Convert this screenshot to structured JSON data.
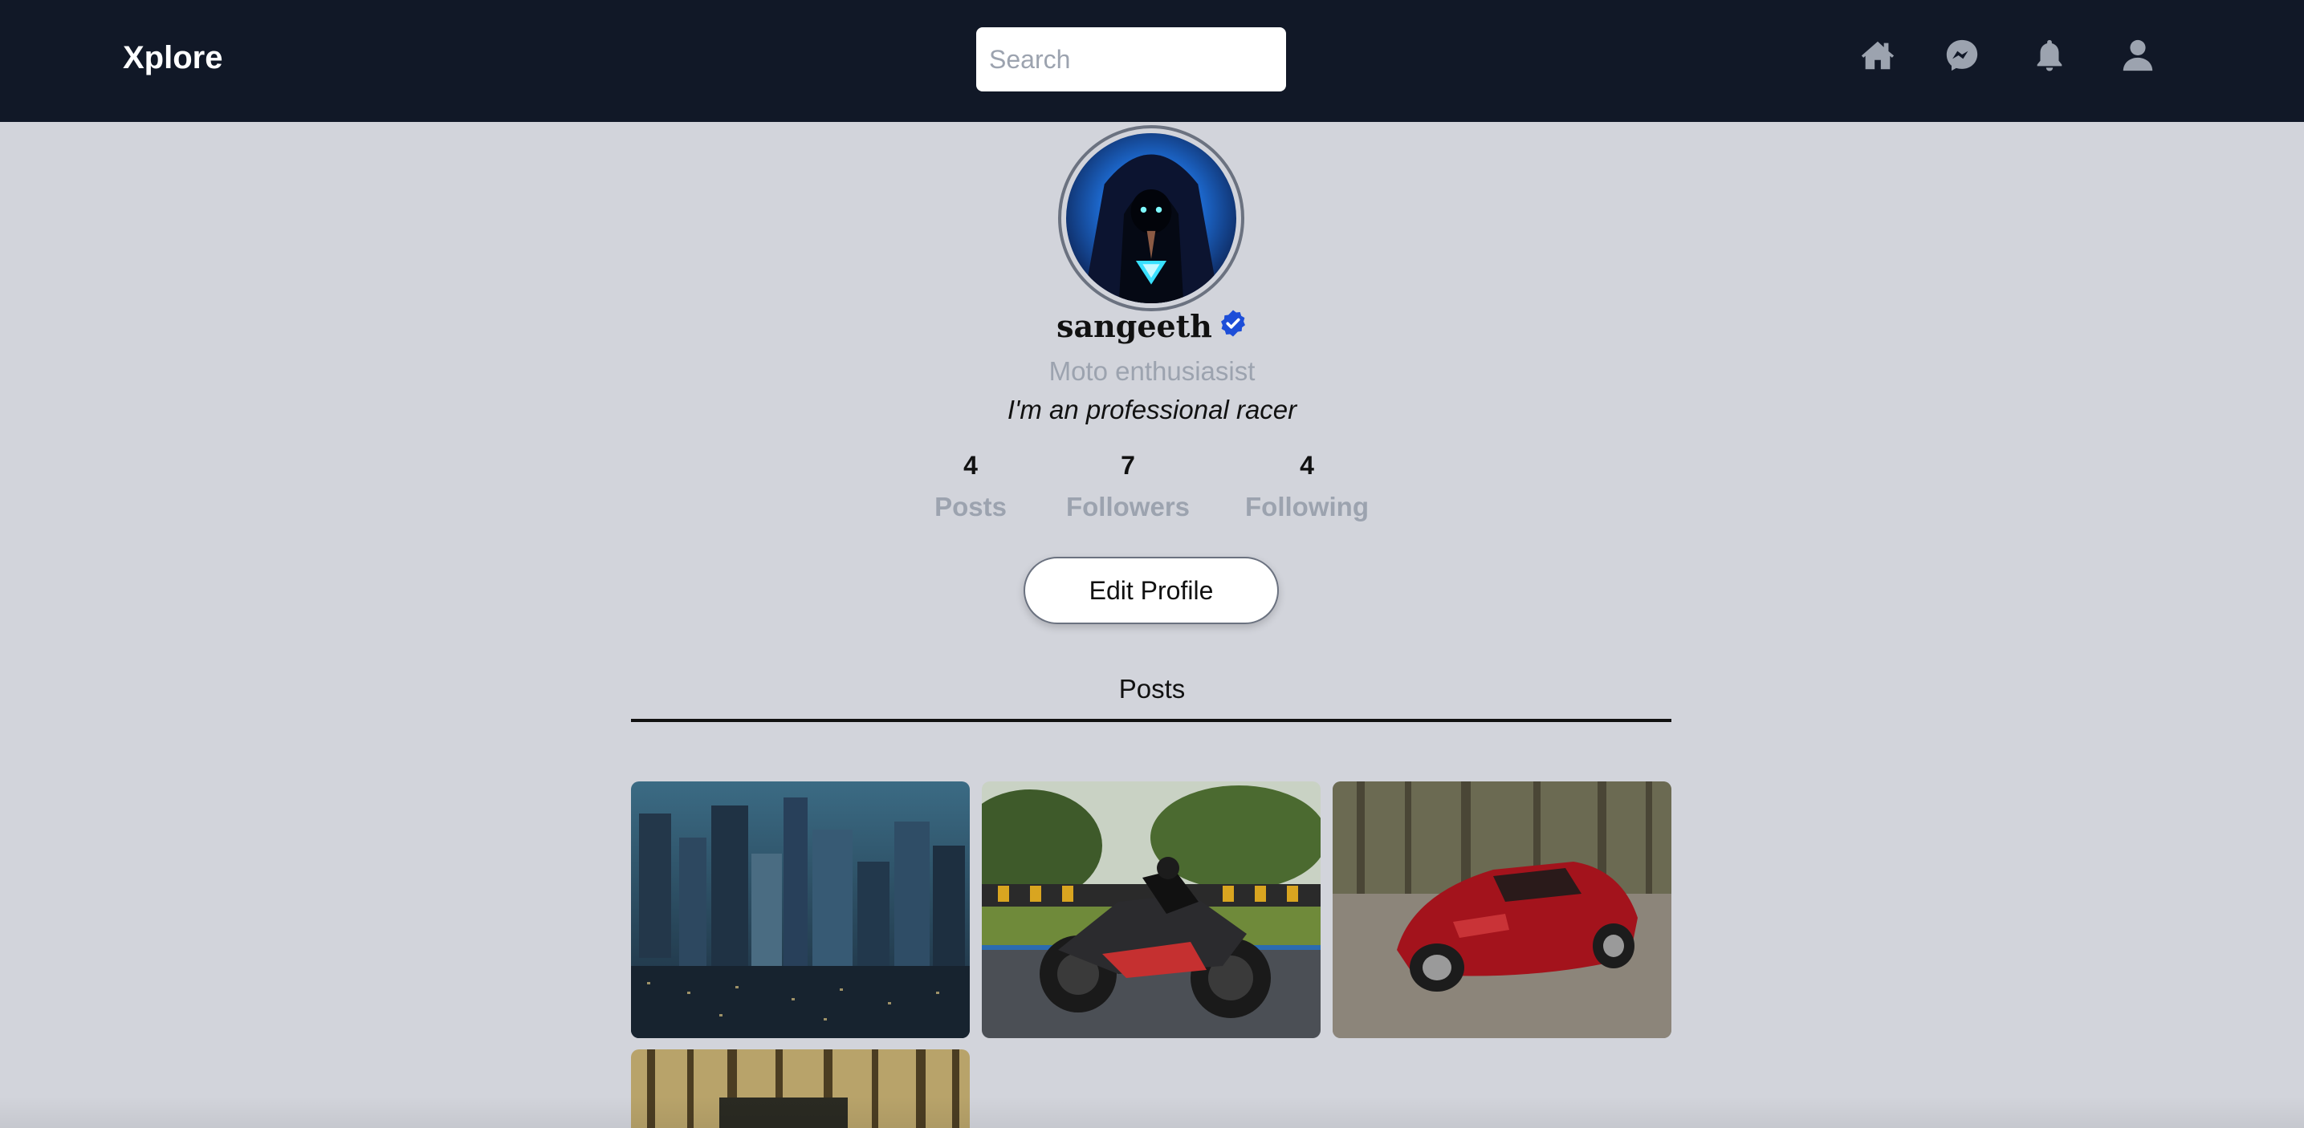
{
  "navbar": {
    "brand": "Xplore",
    "search_placeholder": "Search",
    "icons": [
      "home-icon",
      "messenger-icon",
      "bell-icon",
      "user-icon"
    ]
  },
  "profile": {
    "username": "sangeeth",
    "verified": true,
    "tagline": "Moto enthusiasist",
    "bio": "I'm an professional racer",
    "stats": [
      {
        "value": "4",
        "label": "Posts"
      },
      {
        "value": "7",
        "label": "Followers"
      },
      {
        "value": "4",
        "label": "Following"
      }
    ],
    "edit_button": "Edit Profile"
  },
  "tabs": {
    "posts_label": "Posts"
  },
  "colors": {
    "navbar_bg": "#111827",
    "page_bg": "#d2d4db",
    "muted_text": "#9ca3af",
    "verified_badge": "#1d4ed8"
  }
}
